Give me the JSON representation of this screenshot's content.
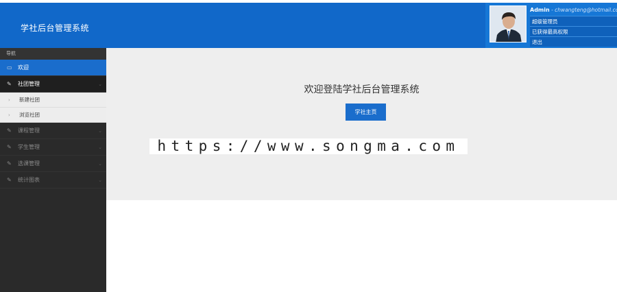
{
  "header": {
    "brand": "学社后台管理系统"
  },
  "user": {
    "name": "Admin",
    "email": " - chwangteng@hotmail.cc",
    "menu": [
      "超级管理员",
      "已获得最高权限",
      "退出"
    ]
  },
  "sidebar": {
    "title": "导航",
    "items": [
      {
        "label": "欢迎",
        "icon": "monitor-icon",
        "state": "active"
      },
      {
        "label": "社团管理",
        "icon": "pencil-icon",
        "state": "open",
        "sub": [
          "新建社团",
          "浏览社团"
        ]
      },
      {
        "label": "课程管理",
        "icon": "pencil-icon",
        "state": "collapsed"
      },
      {
        "label": "学生管理",
        "icon": "pencil-icon",
        "state": "collapsed"
      },
      {
        "label": "选课管理",
        "icon": "pencil-icon",
        "state": "collapsed"
      },
      {
        "label": "统计图表",
        "icon": "pencil-icon",
        "state": "collapsed"
      }
    ]
  },
  "main": {
    "welcome": "欢迎登陆学社后台管理系统",
    "button": "学社主页"
  },
  "watermark": "https://www.songma.com",
  "colors": {
    "header": "#1168c9",
    "active": "#1a6dcc",
    "sidebar": "#2a2a2a",
    "content_bg": "#eeeeee"
  }
}
